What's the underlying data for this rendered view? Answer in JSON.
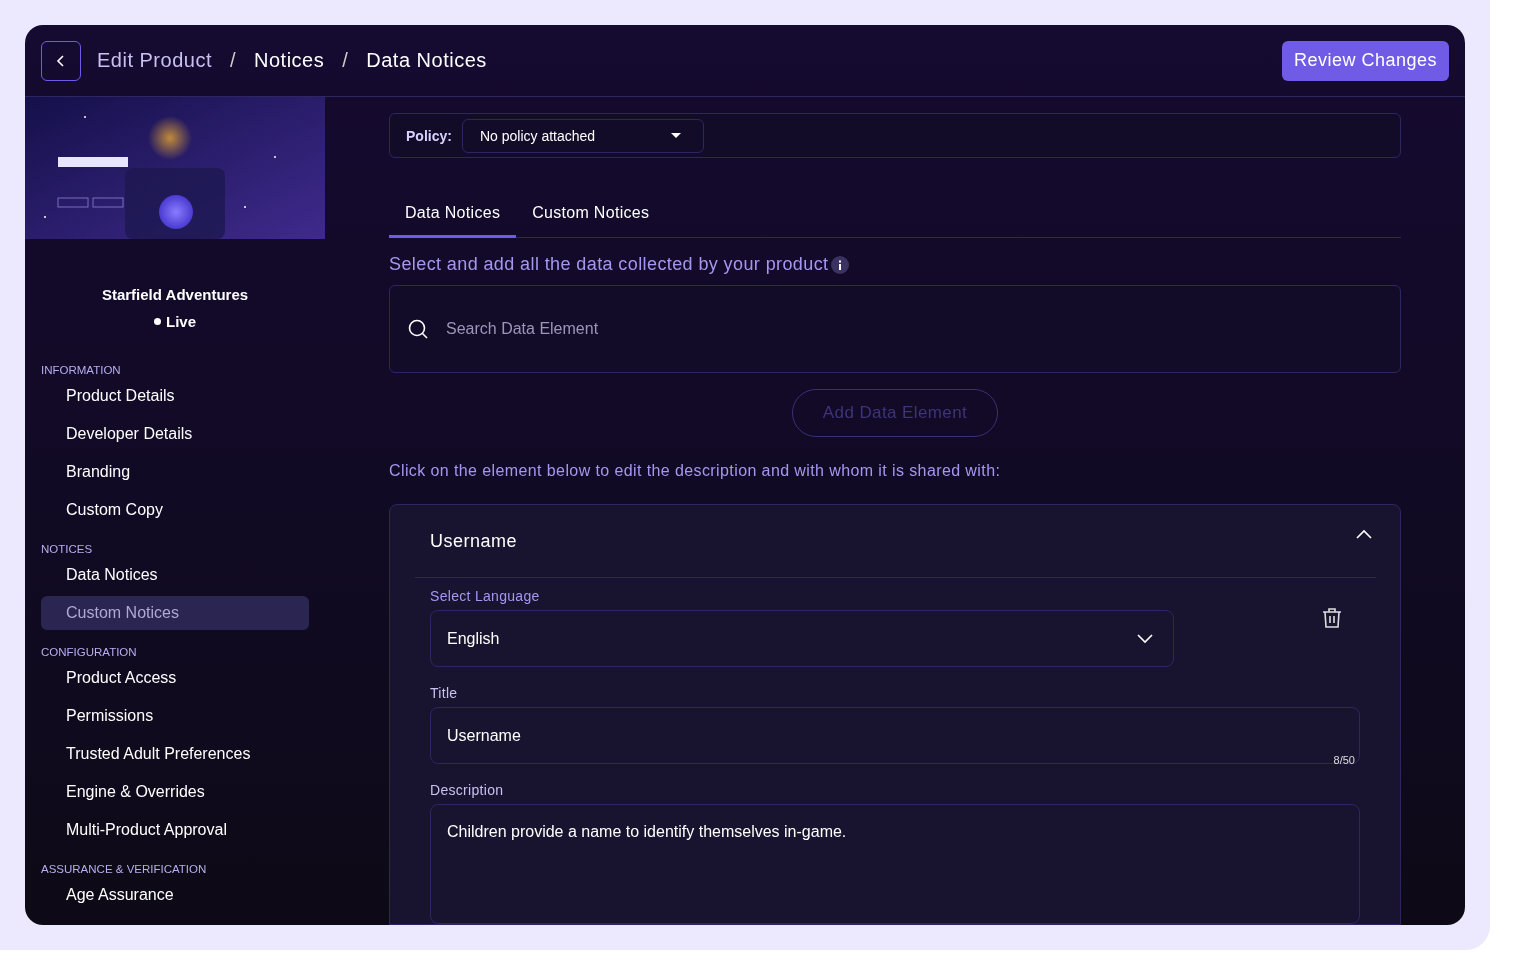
{
  "header": {
    "breadcrumbs": [
      {
        "label": "Edit Product",
        "kind": "link"
      },
      {
        "label": "Notices",
        "kind": "current"
      },
      {
        "label": "Data Notices",
        "kind": "current"
      }
    ],
    "separator": "/",
    "action": "Review Changes"
  },
  "sidebar": {
    "product_name": "Starfield Adventures",
    "status": "Live",
    "sections": [
      {
        "title": "INFORMATION",
        "items": [
          {
            "label": "Product Details",
            "selected": false
          },
          {
            "label": "Developer Details",
            "selected": false
          },
          {
            "label": "Branding",
            "selected": false
          },
          {
            "label": "Custom Copy",
            "selected": false
          }
        ]
      },
      {
        "title": "NOTICES",
        "items": [
          {
            "label": "Data Notices",
            "selected": false
          },
          {
            "label": "Custom Notices",
            "selected": true
          }
        ]
      },
      {
        "title": "CONFIGURATION",
        "items": [
          {
            "label": "Product Access",
            "selected": false
          },
          {
            "label": "Permissions",
            "selected": false
          },
          {
            "label": "Trusted Adult Preferences",
            "selected": false
          },
          {
            "label": "Engine & Overrides",
            "selected": false
          },
          {
            "label": "Multi-Product Approval",
            "selected": false
          }
        ]
      },
      {
        "title": "ASSURANCE & VERIFICATION",
        "items": [
          {
            "label": "Age Assurance",
            "selected": false
          }
        ]
      }
    ]
  },
  "policy": {
    "label": "Policy:",
    "value": "No policy attached"
  },
  "tabs": [
    {
      "label": "Data Notices",
      "selected": true
    },
    {
      "label": "Custom Notices",
      "selected": false
    }
  ],
  "intro": "Select and add all the data collected by your product",
  "search": {
    "placeholder": "Search Data Element"
  },
  "add_button": {
    "label": "Add Data Element",
    "disabled": true
  },
  "instruction": "Click on the element below to edit the description and with whom it is shared with:",
  "element": {
    "name": "Username",
    "expanded": true,
    "language": {
      "label": "Select Language",
      "value": "English"
    },
    "title": {
      "label": "Title",
      "value": "Username",
      "counter": "8/50"
    },
    "description": {
      "label": "Description",
      "value": "Children provide a name to identify themselves in-game."
    }
  }
}
